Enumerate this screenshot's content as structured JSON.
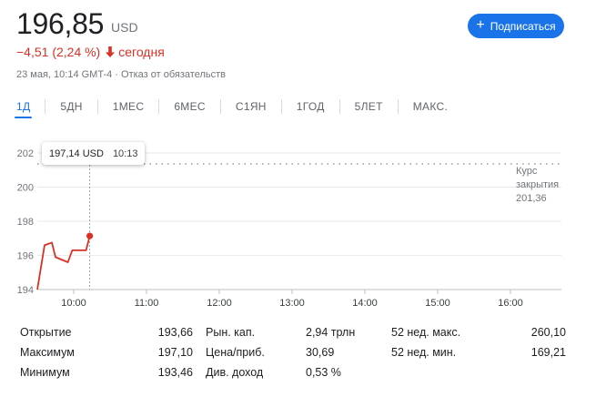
{
  "quote": {
    "price": "196,85",
    "currency": "USD",
    "change": "−4,51 (2,24 %)",
    "change_period": "сегодня",
    "timestamp": "23 мая, 10:14 GMT-4 · Отказ от обязательств"
  },
  "follow_button": {
    "label": "Подписаться"
  },
  "tabs": [
    {
      "label": "1Д",
      "active": true
    },
    {
      "label": "5ДН"
    },
    {
      "label": "1МЕС"
    },
    {
      "label": "6МЕС"
    },
    {
      "label": "С1ЯН"
    },
    {
      "label": "1ГОД"
    },
    {
      "label": "5ЛЕТ"
    },
    {
      "label": "МАКС."
    }
  ],
  "tooltip": {
    "price": "197,14 USD",
    "time": "10:13"
  },
  "previous_close": {
    "label_line1": "Курс",
    "label_line2": "закрытия",
    "value": "201,36"
  },
  "colors": {
    "line": "#d93025",
    "accent": "#1a73e8",
    "grid": "#e8eaed"
  },
  "chart_data": {
    "type": "line",
    "x_unit": "hours",
    "x_ticks": [
      "10:00",
      "11:00",
      "12:00",
      "13:00",
      "14:00",
      "15:00",
      "16:00"
    ],
    "x_tick_values": [
      10,
      11,
      12,
      13,
      14,
      15,
      16
    ],
    "y_ticks": [
      "194",
      "196",
      "198",
      "200",
      "202"
    ],
    "y_tick_values": [
      194,
      196,
      198,
      200,
      202
    ],
    "xlim": [
      9.5,
      16.7
    ],
    "ylim": [
      194,
      202
    ],
    "series": [
      {
        "x": [
          9.5,
          9.6,
          9.7,
          9.75,
          9.92,
          9.98,
          10.17,
          10.22
        ],
        "y": [
          194.0,
          196.6,
          196.75,
          195.9,
          195.6,
          196.3,
          196.3,
          197.14
        ]
      }
    ],
    "reference_line": {
      "y": 201.36,
      "label": "Курс закрытия 201,36"
    },
    "crosshair_x": 10.22
  },
  "stats": [
    [
      {
        "label": "Открытие",
        "value": "193,66"
      },
      {
        "label": "Рын. кап.",
        "value": "2,94 трлн"
      },
      {
        "label": "52 нед. макс.",
        "value": "260,10"
      }
    ],
    [
      {
        "label": "Максимум",
        "value": "197,10"
      },
      {
        "label": "Цена/приб.",
        "value": "30,69"
      },
      {
        "label": "52 нед. мин.",
        "value": "169,21"
      }
    ],
    [
      {
        "label": "Минимум",
        "value": "193,46"
      },
      {
        "label": "Див. доход",
        "value": "0,53 %"
      }
    ]
  ]
}
